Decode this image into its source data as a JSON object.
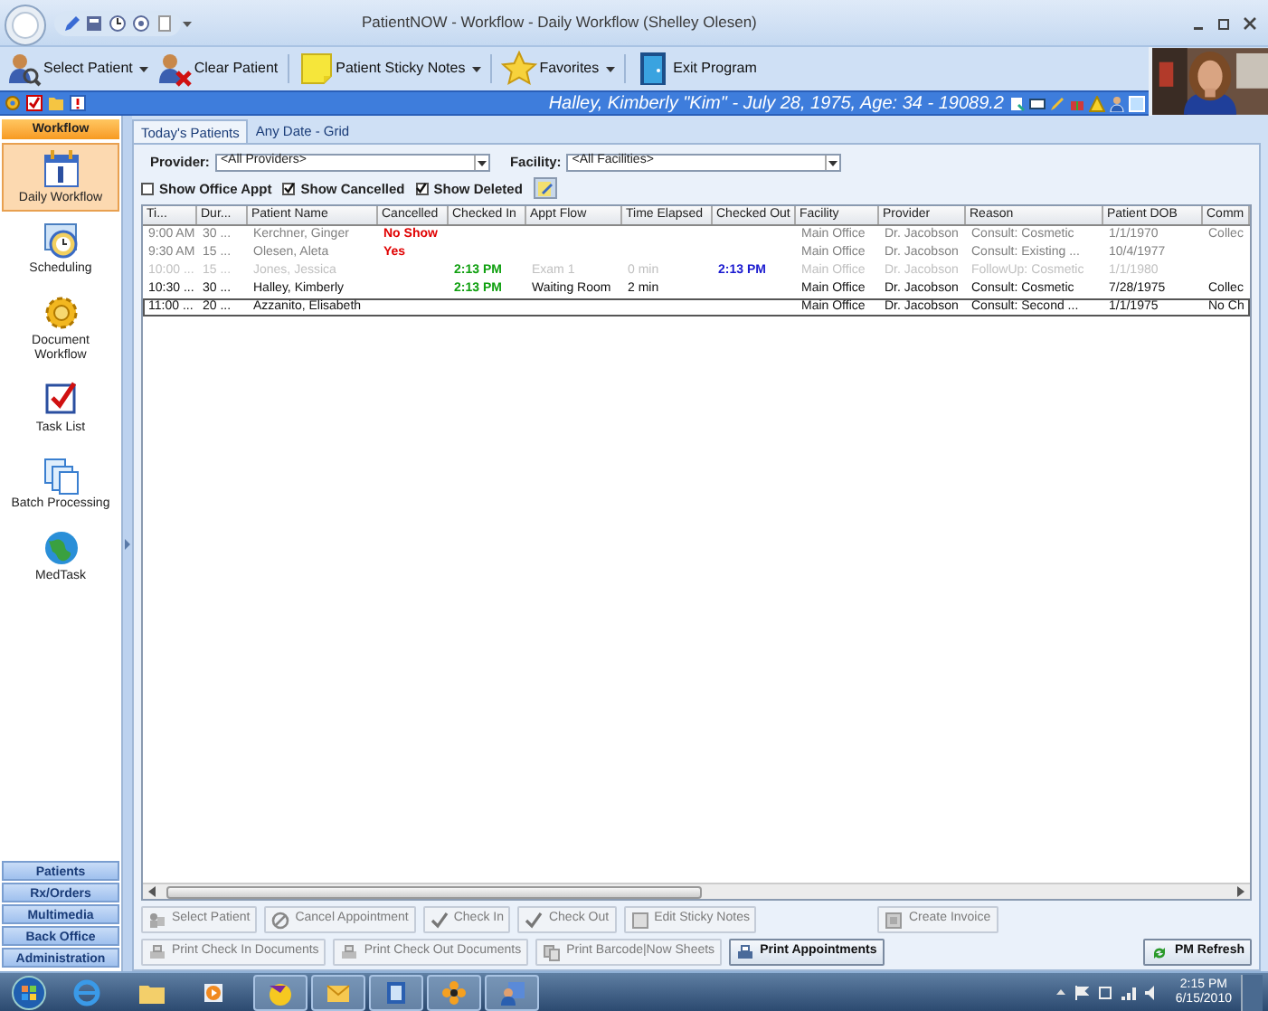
{
  "window": {
    "title": "PatientNOW - Workflow - Daily Workflow (Shelley Olesen)"
  },
  "toolbar": [
    {
      "label": "Select Patient",
      "dropdown": true
    },
    {
      "label": "Clear Patient",
      "dropdown": false
    },
    {
      "label": "Patient Sticky Notes",
      "dropdown": true
    },
    {
      "label": "Favorites",
      "dropdown": true
    },
    {
      "label": "Exit Program",
      "dropdown": false
    }
  ],
  "patient_banner": {
    "text": "Halley, Kimberly \"Kim\" - July 28, 1975, Age: 34 - 19089.2"
  },
  "sidebar": {
    "header": "Workflow",
    "items": [
      {
        "label": "Daily Workflow",
        "selected": true
      },
      {
        "label": "Scheduling",
        "selected": false
      },
      {
        "label": "Document Workflow",
        "selected": false
      },
      {
        "label": "Task List",
        "selected": false
      },
      {
        "label": "Batch Processing",
        "selected": false
      },
      {
        "label": "MedTask",
        "selected": false
      }
    ],
    "nav_buttons": [
      "Patients",
      "Rx/Orders",
      "Multimedia",
      "Back Office",
      "Administration"
    ]
  },
  "tabs": [
    {
      "label": "Today's Patients",
      "selected": true
    },
    {
      "label": "Any Date - Grid",
      "selected": false
    }
  ],
  "filters": {
    "provider": {
      "label": "Provider:",
      "value": "<All Providers>"
    },
    "facility": {
      "label": "Facility:",
      "value": "<All Facilities>"
    },
    "checkboxes": [
      {
        "label": "Show Office Appt",
        "checked": false
      },
      {
        "label": "Show Cancelled",
        "checked": true
      },
      {
        "label": "Show Deleted",
        "checked": true
      }
    ]
  },
  "table": {
    "columns": [
      "Ti...",
      "Dur...",
      "Patient Name",
      "Cancelled",
      "Checked In",
      "Appt Flow",
      "Time Elapsed",
      "Checked Out",
      "Facility",
      "Provider",
      "Reason",
      "Patient DOB",
      "Comm"
    ],
    "rows": [
      {
        "kind": "cancelled",
        "selected": false,
        "cells": {
          "time": "9:00 AM",
          "duration": "30 ...",
          "patient_name": "Kerchner, Ginger",
          "cancelled": "No Show",
          "facility": "Main Office",
          "provider": "Dr. Jacobson",
          "reason": "Consult: Cosmetic",
          "patient_dob": "1/1/1970",
          "column_13": "Collec"
        }
      },
      {
        "kind": "cancelled",
        "selected": false,
        "cells": {
          "time": "9:30 AM",
          "duration": "15 ...",
          "patient_name": "Olesen, Aleta",
          "cancelled": "Yes",
          "facility": "Main Office",
          "provider": "Dr. Jacobson",
          "reason": "Consult: Existing ...",
          "patient_dob": "10/4/1977"
        }
      },
      {
        "kind": "deleted",
        "selected": false,
        "cells": {
          "time": "10:00 ...",
          "duration": "15 ...",
          "patient_name": "Jones, Jessica",
          "checked_in": "2:13 PM",
          "appt_flow": "Exam 1",
          "time_elapsed": "0 min",
          "checked_out": "2:13 PM",
          "facility": "Main Office",
          "provider": "Dr. Jacobson",
          "reason": "FollowUp: Cosmetic",
          "patient_dob": "1/1/1980"
        }
      },
      {
        "kind": "normal",
        "selected": false,
        "cells": {
          "time": "10:30 ...",
          "duration": "30 ...",
          "patient_name": "Halley, Kimberly",
          "checked_in": "2:13 PM",
          "appt_flow": "Waiting Room",
          "time_elapsed": "2 min",
          "facility": "Main Office",
          "provider": "Dr. Jacobson",
          "reason": "Consult: Cosmetic",
          "patient_dob": "7/28/1975",
          "column_13": "Collec"
        }
      },
      {
        "kind": "normal",
        "selected": true,
        "cells": {
          "time": "11:00 ...",
          "duration": "20 ...",
          "patient_name": "Azzanito, Elisabeth",
          "facility": "Main Office",
          "provider": "Dr. Jacobson",
          "reason": "Consult: Second ...",
          "patient_dob": "1/1/1975",
          "column_13": "No Ch"
        }
      }
    ]
  },
  "action_rows": [
    [
      {
        "label": "Select Patient",
        "disabled": true
      },
      {
        "label": "Cancel Appointment",
        "disabled": true
      },
      {
        "label": "Check In",
        "disabled": true
      },
      {
        "label": "Check Out",
        "disabled": true
      },
      {
        "label": "Edit Sticky Notes",
        "disabled": true
      },
      {
        "label": "Create Invoice",
        "disabled": true
      }
    ],
    [
      {
        "label": "Print Check In Documents",
        "disabled": true
      },
      {
        "label": "Print Check Out Documents",
        "disabled": true
      },
      {
        "label": "Print Barcode|Now Sheets",
        "disabled": true
      },
      {
        "label": "Print Appointments",
        "disabled": false
      },
      {
        "label": "PM Refresh",
        "disabled": false
      }
    ]
  ],
  "taskbar": {
    "time": "2:15 PM",
    "date": "6/15/2010"
  }
}
